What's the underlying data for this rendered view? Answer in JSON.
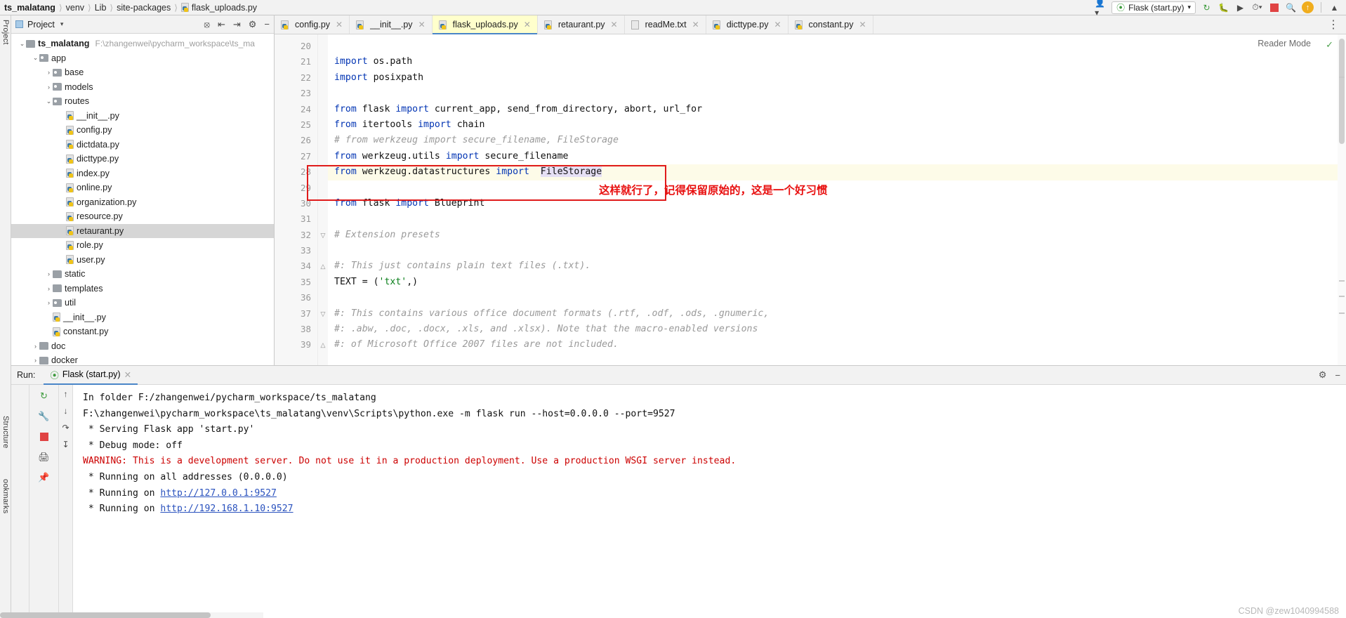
{
  "titlebar": {
    "crumbs": [
      "ts_malatang",
      "venv",
      "Lib",
      "site-packages",
      "flask_uploads.py"
    ],
    "run_config": "Flask (start.py)",
    "icons": {
      "user": "user-icon",
      "rerun": "rerun-icon",
      "debug": "debug-bug-icon",
      "coverage": "run-coverage-icon",
      "profile": "profile-icon",
      "stop": "stop-icon",
      "search": "search-icon",
      "update": "update-arrow-icon"
    }
  },
  "project_panel": {
    "title": "Project",
    "tree": [
      {
        "depth": 0,
        "arrow": "v",
        "icon": "folder",
        "label": "ts_malatang",
        "bold": true,
        "path": "F:\\zhangenwei\\pycharm_workspace\\ts_ma",
        "selected": false
      },
      {
        "depth": 1,
        "arrow": "v",
        "icon": "folder-src",
        "label": "app",
        "bold": false,
        "path": "",
        "selected": false
      },
      {
        "depth": 2,
        "arrow": ">",
        "icon": "folder-src",
        "label": "base",
        "bold": false,
        "path": "",
        "selected": false
      },
      {
        "depth": 2,
        "arrow": ">",
        "icon": "folder-src",
        "label": "models",
        "bold": false,
        "path": "",
        "selected": false
      },
      {
        "depth": 2,
        "arrow": "v",
        "icon": "folder-src",
        "label": "routes",
        "bold": false,
        "path": "",
        "selected": false
      },
      {
        "depth": 3,
        "arrow": "",
        "icon": "py",
        "label": "__init__.py",
        "bold": false,
        "path": "",
        "selected": false
      },
      {
        "depth": 3,
        "arrow": "",
        "icon": "py",
        "label": "config.py",
        "bold": false,
        "path": "",
        "selected": false
      },
      {
        "depth": 3,
        "arrow": "",
        "icon": "py",
        "label": "dictdata.py",
        "bold": false,
        "path": "",
        "selected": false
      },
      {
        "depth": 3,
        "arrow": "",
        "icon": "py",
        "label": "dicttype.py",
        "bold": false,
        "path": "",
        "selected": false
      },
      {
        "depth": 3,
        "arrow": "",
        "icon": "py",
        "label": "index.py",
        "bold": false,
        "path": "",
        "selected": false
      },
      {
        "depth": 3,
        "arrow": "",
        "icon": "py",
        "label": "online.py",
        "bold": false,
        "path": "",
        "selected": false
      },
      {
        "depth": 3,
        "arrow": "",
        "icon": "py",
        "label": "organization.py",
        "bold": false,
        "path": "",
        "selected": false
      },
      {
        "depth": 3,
        "arrow": "",
        "icon": "py",
        "label": "resource.py",
        "bold": false,
        "path": "",
        "selected": false
      },
      {
        "depth": 3,
        "arrow": "",
        "icon": "py",
        "label": "retaurant.py",
        "bold": false,
        "path": "",
        "selected": true
      },
      {
        "depth": 3,
        "arrow": "",
        "icon": "py",
        "label": "role.py",
        "bold": false,
        "path": "",
        "selected": false
      },
      {
        "depth": 3,
        "arrow": "",
        "icon": "py",
        "label": "user.py",
        "bold": false,
        "path": "",
        "selected": false
      },
      {
        "depth": 2,
        "arrow": ">",
        "icon": "folder",
        "label": "static",
        "bold": false,
        "path": "",
        "selected": false
      },
      {
        "depth": 2,
        "arrow": ">",
        "icon": "folder",
        "label": "templates",
        "bold": false,
        "path": "",
        "selected": false
      },
      {
        "depth": 2,
        "arrow": ">",
        "icon": "folder-src",
        "label": "util",
        "bold": false,
        "path": "",
        "selected": false
      },
      {
        "depth": 2,
        "arrow": "",
        "icon": "py",
        "label": "__init__.py",
        "bold": false,
        "path": "",
        "selected": false
      },
      {
        "depth": 2,
        "arrow": "",
        "icon": "py",
        "label": "constant.py",
        "bold": false,
        "path": "",
        "selected": false
      },
      {
        "depth": 1,
        "arrow": ">",
        "icon": "folder",
        "label": "doc",
        "bold": false,
        "path": "",
        "selected": false
      },
      {
        "depth": 1,
        "arrow": ">",
        "icon": "folder",
        "label": "docker",
        "bold": false,
        "path": "",
        "selected": false
      }
    ]
  },
  "editor": {
    "tabs": [
      {
        "label": "config.py",
        "icon": "py",
        "active": false
      },
      {
        "label": "__init__.py",
        "icon": "py",
        "active": false
      },
      {
        "label": "flask_uploads.py",
        "icon": "py",
        "active": true
      },
      {
        "label": "retaurant.py",
        "icon": "py",
        "active": false
      },
      {
        "label": "readMe.txt",
        "icon": "txt",
        "active": false
      },
      {
        "label": "dicttype.py",
        "icon": "py",
        "active": false
      },
      {
        "label": "constant.py",
        "icon": "py",
        "active": false
      }
    ],
    "reader_mode": "Reader Mode",
    "annotation": "这样就行了，记得保留原始的，这是一个好习惯",
    "annotation_color": "#e81010",
    "lines": [
      {
        "n": "20",
        "fold": "",
        "hl": false,
        "segs": [
          {
            "t": "",
            "c": ""
          }
        ]
      },
      {
        "n": "21",
        "fold": "",
        "hl": false,
        "segs": [
          {
            "t": "import",
            "c": "kw"
          },
          {
            "t": " os.path",
            "c": ""
          }
        ]
      },
      {
        "n": "22",
        "fold": "",
        "hl": false,
        "segs": [
          {
            "t": "import",
            "c": "kw"
          },
          {
            "t": " posixpath",
            "c": ""
          }
        ]
      },
      {
        "n": "23",
        "fold": "",
        "hl": false,
        "segs": [
          {
            "t": "",
            "c": ""
          }
        ]
      },
      {
        "n": "24",
        "fold": "",
        "hl": false,
        "segs": [
          {
            "t": "from",
            "c": "kw"
          },
          {
            "t": " flask ",
            "c": ""
          },
          {
            "t": "import",
            "c": "kw"
          },
          {
            "t": " current_app, send_from_directory, abort, url_for",
            "c": ""
          }
        ]
      },
      {
        "n": "25",
        "fold": "",
        "hl": false,
        "segs": [
          {
            "t": "from",
            "c": "kw"
          },
          {
            "t": " itertools ",
            "c": ""
          },
          {
            "t": "import",
            "c": "kw"
          },
          {
            "t": " chain",
            "c": ""
          }
        ]
      },
      {
        "n": "26",
        "fold": "",
        "hl": false,
        "segs": [
          {
            "t": "# from werkzeug import secure_filename, FileStorage",
            "c": "cm"
          }
        ]
      },
      {
        "n": "27",
        "fold": "",
        "hl": false,
        "segs": [
          {
            "t": "from",
            "c": "kw"
          },
          {
            "t": " werkzeug.utils ",
            "c": ""
          },
          {
            "t": "import",
            "c": "kw"
          },
          {
            "t": " secure_filename",
            "c": ""
          }
        ]
      },
      {
        "n": "28",
        "fold": "",
        "hl": true,
        "segs": [
          {
            "t": "from",
            "c": "kw"
          },
          {
            "t": " werkzeug.datastructures ",
            "c": ""
          },
          {
            "t": "import",
            "c": "kw"
          },
          {
            "t": "  ",
            "c": ""
          },
          {
            "t": "FileStorage",
            "c": "occ"
          }
        ]
      },
      {
        "n": "29",
        "fold": "",
        "hl": false,
        "segs": [
          {
            "t": "",
            "c": ""
          }
        ]
      },
      {
        "n": "30",
        "fold": "",
        "hl": false,
        "segs": [
          {
            "t": "from",
            "c": "kw"
          },
          {
            "t": " flask ",
            "c": ""
          },
          {
            "t": "import",
            "c": "kw"
          },
          {
            "t": " Blueprint",
            "c": ""
          }
        ]
      },
      {
        "n": "31",
        "fold": "",
        "hl": false,
        "segs": [
          {
            "t": "",
            "c": ""
          }
        ]
      },
      {
        "n": "32",
        "fold": "v",
        "hl": false,
        "segs": [
          {
            "t": "# Extension presets",
            "c": "cm"
          }
        ]
      },
      {
        "n": "33",
        "fold": "",
        "hl": false,
        "segs": [
          {
            "t": "",
            "c": ""
          }
        ]
      },
      {
        "n": "34",
        "fold": "^",
        "hl": false,
        "segs": [
          {
            "t": "#: This just contains plain text files (.txt).",
            "c": "cm"
          }
        ]
      },
      {
        "n": "35",
        "fold": "",
        "hl": false,
        "segs": [
          {
            "t": "TEXT = (",
            "c": ""
          },
          {
            "t": "'txt'",
            "c": "str"
          },
          {
            "t": ",)",
            "c": ""
          }
        ]
      },
      {
        "n": "36",
        "fold": "",
        "hl": false,
        "segs": [
          {
            "t": "",
            "c": ""
          }
        ]
      },
      {
        "n": "37",
        "fold": "v",
        "hl": false,
        "segs": [
          {
            "t": "#: This contains various office document formats (.rtf, .odf, .ods, .gnumeric,",
            "c": "cm"
          }
        ]
      },
      {
        "n": "38",
        "fold": "",
        "hl": false,
        "segs": [
          {
            "t": "#: .abw, .doc, .docx, .xls, and .xlsx). Note that the macro-enabled versions",
            "c": "cm"
          }
        ]
      },
      {
        "n": "39",
        "fold": "^",
        "hl": false,
        "segs": [
          {
            "t": "#: of Microsoft Office 2007 files are not included.",
            "c": "cm"
          }
        ]
      }
    ]
  },
  "run_panel": {
    "label": "Run:",
    "tab": "Flask (start.py)",
    "console": [
      {
        "text": "In folder F:/zhangenwei/pycharm_workspace/ts_malatang",
        "style": "normal"
      },
      {
        "text": "F:\\zhangenwei\\pycharm_workspace\\ts_malatang\\venv\\Scripts\\python.exe -m flask run --host=0.0.0.0 --port=9527",
        "style": "normal"
      },
      {
        "text": " * Serving Flask app 'start.py'",
        "style": "normal"
      },
      {
        "text": " * Debug mode: off",
        "style": "normal"
      },
      {
        "text": "WARNING: This is a development server. Do not use it in a production deployment. Use a production WSGI server instead.",
        "style": "warn"
      },
      {
        "text": " * Running on all addresses (0.0.0.0)",
        "style": "normal"
      },
      {
        "text": " * Running on http://127.0.0.1:9527",
        "style": "link",
        "prefix": " * Running on ",
        "link": "http://127.0.0.1:9527"
      },
      {
        "text": " * Running on http://192.168.1.10:9527",
        "style": "link",
        "prefix": " * Running on ",
        "link": "http://192.168.1.10:9527"
      }
    ],
    "watermark": "CSDN @zew1040994588"
  },
  "left_rail": {
    "project": "Project",
    "structure": "Structure",
    "bookmarks": "ookmarks"
  }
}
